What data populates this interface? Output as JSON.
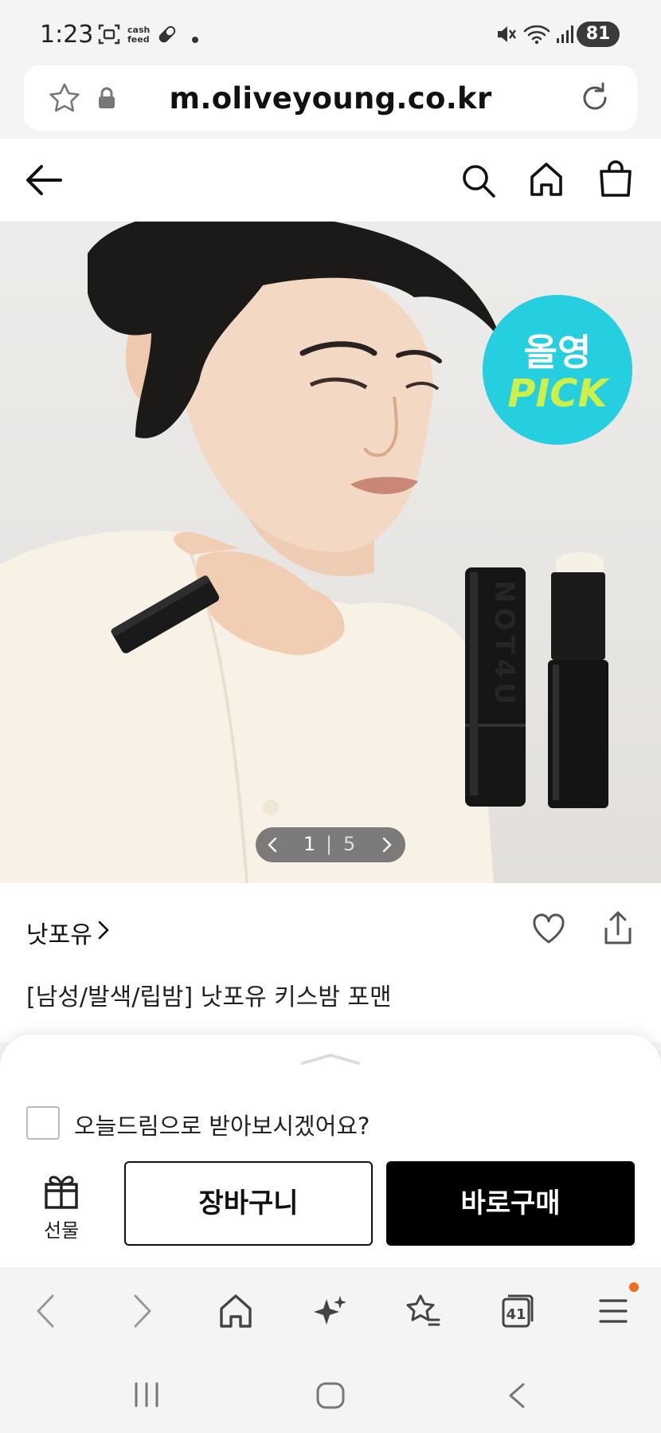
{
  "status_bar": {
    "time": "1:23",
    "cashfeed_label_top": "cash",
    "cashfeed_label_bottom": "feed",
    "battery": "81",
    "icons": [
      "screenshot-icon",
      "cashfeed-icon",
      "pill-icon",
      "dot-icon",
      "mute-icon",
      "wifi-icon",
      "signal-icon",
      "battery-icon"
    ]
  },
  "url_bar": {
    "url": "m.oliveyoung.co.kr",
    "icons": [
      "star-icon",
      "lock-icon",
      "reload-icon"
    ]
  },
  "header": {
    "icons": [
      "back-arrow-icon",
      "search-icon",
      "home-icon",
      "shopping-bag-icon"
    ]
  },
  "hero": {
    "badge_line1": "올영",
    "badge_line2": "PICK",
    "product_print": "NOT4U",
    "pager_current": "1",
    "pager_sep": "|",
    "pager_total": "5"
  },
  "product": {
    "brand": "낫포유",
    "title": "[남성/발색/립밤] 낫포유 키스밤 포맨"
  },
  "purchase_sheet": {
    "delivery_option_label": "오늘드림으로 받아보시겠어요?",
    "delivery_option_checked": false,
    "gift_label": "선물",
    "cart_button": "장바구니",
    "buy_button": "바로구매"
  },
  "browser_nav": {
    "tab_count": "41",
    "icons": [
      "back-icon",
      "forward-icon",
      "home-icon",
      "sparkle-icon",
      "bookmarks-icon",
      "tabs-icon",
      "menu-icon"
    ],
    "colors": {
      "notification_dot": "#f26b21"
    }
  },
  "colors": {
    "pick_badge": "#25cfe0",
    "pick_text": "#cff048",
    "buy_button": "#000000"
  }
}
